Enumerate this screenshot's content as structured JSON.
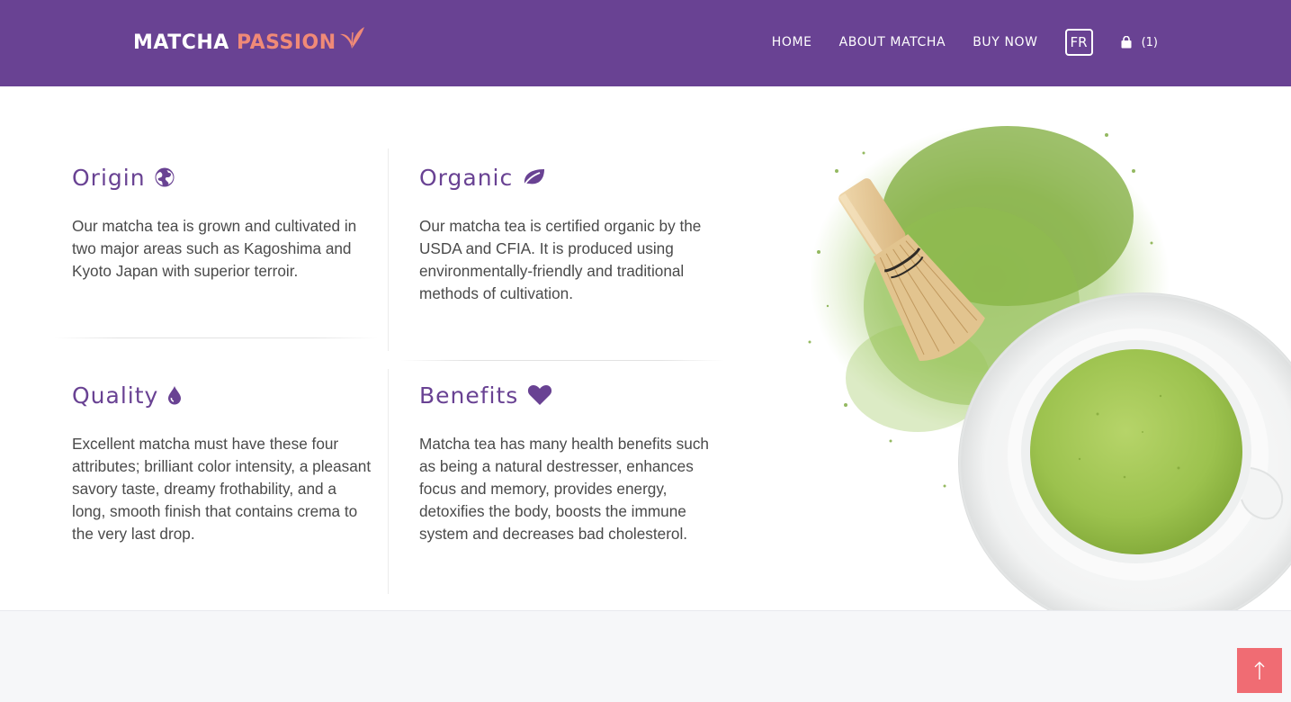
{
  "brand": {
    "name_part1": "MATCHA",
    "name_part2": "PASSION",
    "color_primary": "#694293",
    "color_accent": "#f08a77"
  },
  "nav": {
    "items": [
      "HOME",
      "ABOUT MATCHA",
      "BUY NOW"
    ],
    "language": "FR",
    "cart_count": "(1)",
    "cart_icon": "shopping-bag-icon"
  },
  "features": [
    {
      "title": "Origin",
      "icon": "globe-icon",
      "text": "Our matcha tea is grown and cultivated in two major areas such as Kagoshima and Kyoto Japan with superior terroir."
    },
    {
      "title": "Organic",
      "icon": "leaf-icon",
      "text": "Our matcha tea is certified organic by the USDA and CFIA. It is produced using environmentally-friendly and traditional methods of cultivation."
    },
    {
      "title": "Quality",
      "icon": "tint-icon",
      "text": "Excellent matcha must have these four attributes; brilliant color intensity, a pleasant savory taste, dreamy frothability, and a long, smooth finish that contains crema to the very last drop."
    },
    {
      "title": "Benefits",
      "icon": "heart-icon",
      "text": "Matcha tea has many health benefits such as being a natural destresser, enhances focus and memory, provides energy, detoxifies the body, boosts the immune system and decreases bad cholesterol."
    }
  ],
  "scroll_top": {
    "icon": "arrow-up-icon",
    "color": "#f06c73"
  }
}
